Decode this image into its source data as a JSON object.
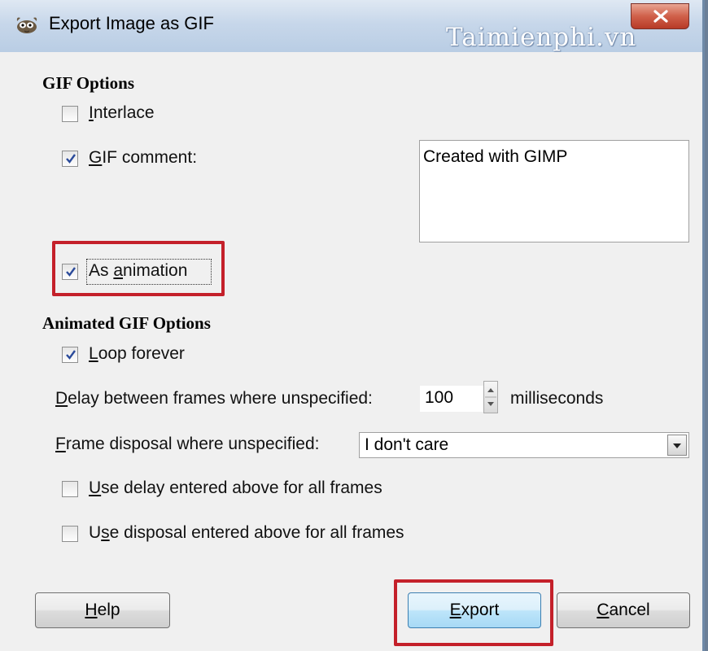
{
  "window": {
    "title": "Export Image as GIF",
    "watermark": "Taimienphi.vn"
  },
  "gif_options": {
    "heading": "GIF Options",
    "interlace": {
      "label_pre": "",
      "label_u": "I",
      "label_post": "nterlace",
      "checked": false
    },
    "gif_comment": {
      "label_pre": "",
      "label_u": "G",
      "label_post": "IF comment:",
      "checked": true
    },
    "comment_text": "Created with GIMP",
    "as_animation": {
      "label_pre": "As ",
      "label_u": "a",
      "label_post": "nimation",
      "checked": true
    }
  },
  "animated_options": {
    "heading": "Animated GIF Options",
    "loop_forever": {
      "label_pre": "",
      "label_u": "L",
      "label_post": "oop forever",
      "checked": true
    },
    "delay": {
      "label_pre": "",
      "label_u": "D",
      "label_post": "elay between frames where unspecified:",
      "value": "100",
      "unit": "milliseconds"
    },
    "disposal": {
      "label_pre": "",
      "label_u": "F",
      "label_post": "rame disposal where unspecified:",
      "value": "I don't care"
    },
    "use_delay": {
      "label_pre": "",
      "label_u": "U",
      "label_post": "se delay entered above for all frames",
      "checked": false
    },
    "use_disposal": {
      "label_pre": "U",
      "label_u": "s",
      "label_post": "e disposal entered above for all frames",
      "checked": false
    }
  },
  "buttons": {
    "help": {
      "label_pre": "",
      "label_u": "H",
      "label_post": "elp"
    },
    "export": {
      "label_pre": "",
      "label_u": "E",
      "label_post": "xport"
    },
    "cancel": {
      "label_pre": "",
      "label_u": "C",
      "label_post": "ancel"
    }
  },
  "icons": {
    "app": "gimp-wilber-icon",
    "close": "close-icon",
    "check": "checkmark-icon",
    "spin": "spin-arrows-icon",
    "dropdown": "chevron-down-icon"
  },
  "colors": {
    "highlight": "#c4202a",
    "close_button": "#c9503a",
    "default_button": "#bde5fa"
  }
}
